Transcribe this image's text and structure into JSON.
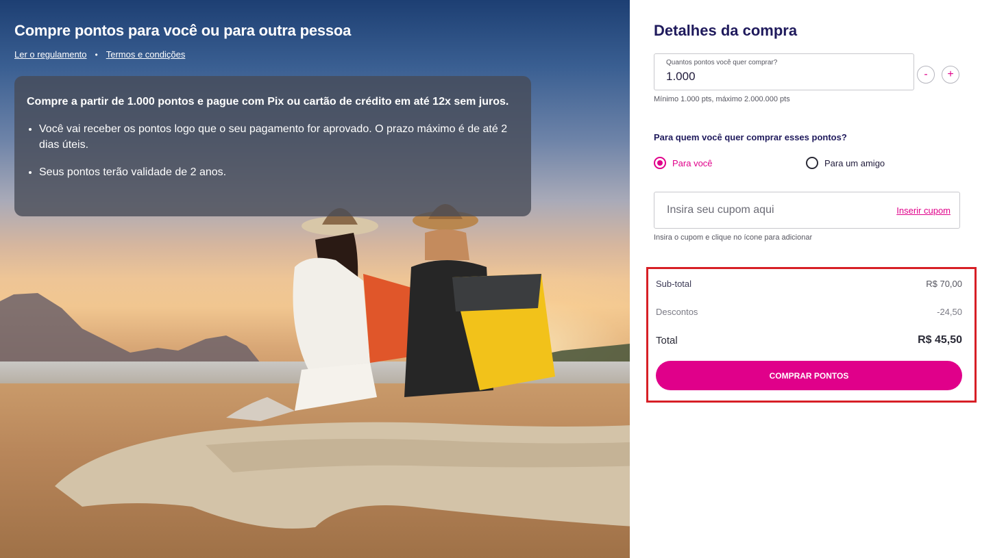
{
  "hero": {
    "title": "Compre pontos para você ou para outra pessoa",
    "link_rules": "Ler o regulamento",
    "link_separator": "•",
    "link_terms": "Termos e condições",
    "info_headline": "Compre a partir de 1.000 pontos e pague com Pix ou cartão de crédito em até 12x sem juros.",
    "info_items": [
      "Você vai receber os pontos logo que o seu pagamento for aprovado. O prazo máximo é de até 2 dias úteis.",
      "Seus pontos terão validade de 2 anos."
    ]
  },
  "panel": {
    "title": "Detalhes da compra",
    "quantity": {
      "label": "Quantos pontos você quer comprar?",
      "value": "1.000",
      "minus": "-",
      "plus": "+",
      "hint": "Mínimo 1.000 pts, máximo 2.000.000 pts"
    },
    "recipient": {
      "question": "Para quem você quer comprar esses pontos?",
      "option_you": "Para você",
      "option_friend": "Para um amigo",
      "selected": "you"
    },
    "coupon": {
      "placeholder": "Insira seu cupom aqui",
      "link": "Inserir cupom",
      "hint": "Insira o cupom e clique no ícone para adicionar"
    },
    "summary": {
      "subtotal_label": "Sub-total",
      "subtotal_value": "R$ 70,00",
      "discount_label": "Descontos",
      "discount_value": "-24,50",
      "total_label": "Total",
      "total_value": "R$ 45,50",
      "buy_button": "COMPRAR PONTOS"
    }
  },
  "colors": {
    "accent": "#e0008a",
    "title": "#1f1a5c",
    "highlight_border": "#d71f26"
  }
}
